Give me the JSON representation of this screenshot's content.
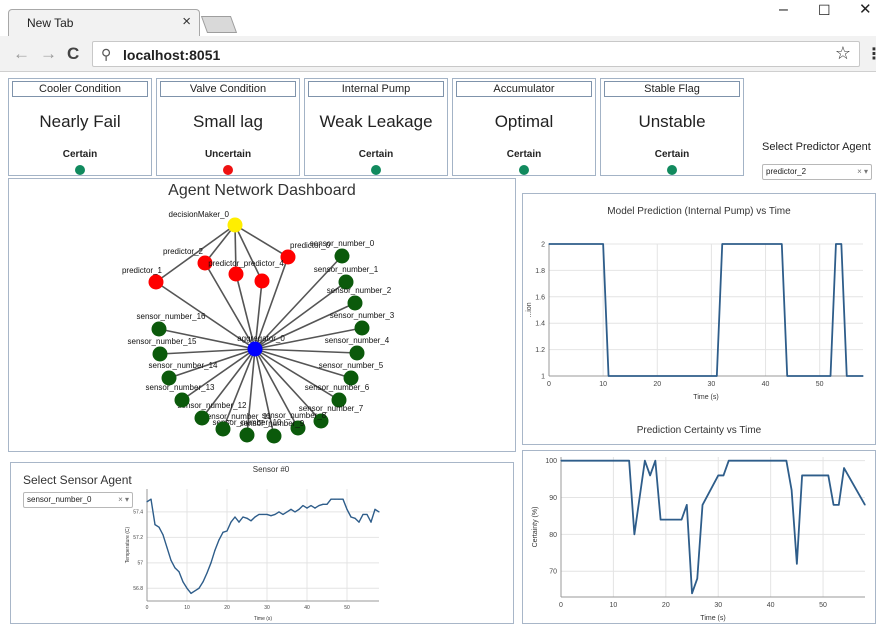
{
  "browser": {
    "tab_title": "New Tab",
    "tab_close": "×",
    "window_controls": [
      "–",
      "☐",
      "✕"
    ],
    "nav": {
      "back": "←",
      "forward": "→",
      "reload": "C",
      "search_icon": "⚲",
      "star": "☆",
      "menu": "⋮"
    },
    "url": "localhost:8051"
  },
  "cards": [
    {
      "header": "Cooler Condition",
      "value": "Nearly Fail",
      "certainty": "Certain",
      "dot_color": "#118a5e"
    },
    {
      "header": "Valve Condition",
      "value": "Small lag",
      "certainty": "Uncertain",
      "dot_color": "#ee1111"
    },
    {
      "header": "Internal Pump",
      "value": "Weak Leakage",
      "certainty": "Certain",
      "dot_color": "#118a5e"
    },
    {
      "header": "Accumulator",
      "value": "Optimal",
      "certainty": "Certain",
      "dot_color": "#118a5e"
    },
    {
      "header": "Stable Flag",
      "value": "Unstable",
      "certainty": "Certain",
      "dot_color": "#118a5e"
    }
  ],
  "predictor_select": {
    "label": "Select Predictor Agent",
    "value": "predictor_2",
    "clear": "×",
    "arrow": "▾"
  },
  "network": {
    "title": "Agent Network Dashboard",
    "colors": {
      "decision": "#ffee00",
      "predictor": "#ff0000",
      "aggregator": "#0000ff",
      "sensor": "#0b5a0b",
      "edge": "#555555"
    },
    "nodes": [
      {
        "id": "decisionMaker_0",
        "type": "decision"
      },
      {
        "id": "predictor_2",
        "type": "predictor"
      },
      {
        "id": "predictor_0",
        "type": "predictor"
      },
      {
        "id": "predictor_1",
        "type": "predictor"
      },
      {
        "id": "predictor_predictor_4",
        "type": "predictor"
      },
      {
        "id": "aggregator_0",
        "type": "aggregator"
      },
      {
        "id": "sensor_number_0",
        "type": "sensor"
      },
      {
        "id": "sensor_number_1",
        "type": "sensor"
      },
      {
        "id": "sensor_number_2",
        "type": "sensor"
      },
      {
        "id": "sensor_number_3",
        "type": "sensor"
      },
      {
        "id": "sensor_number_4",
        "type": "sensor"
      },
      {
        "id": "sensor_number_5",
        "type": "sensor"
      },
      {
        "id": "sensor_number_6",
        "type": "sensor"
      },
      {
        "id": "sensor_number_7",
        "type": "sensor"
      },
      {
        "id": "sensor_number_8",
        "type": "sensor"
      },
      {
        "id": "sensor_number_9",
        "type": "sensor"
      },
      {
        "id": "sensor_number_10",
        "type": "sensor"
      },
      {
        "id": "sensor_number_11",
        "type": "sensor"
      },
      {
        "id": "sensor_number_12",
        "type": "sensor"
      },
      {
        "id": "sensor_number_13",
        "type": "sensor"
      },
      {
        "id": "sensor_number_14",
        "type": "sensor"
      },
      {
        "id": "sensor_number_15",
        "type": "sensor"
      },
      {
        "id": "sensor_number_16",
        "type": "sensor"
      }
    ]
  },
  "sensor_select": {
    "label": "Select Sensor Agent",
    "value": "sensor_number_0",
    "clear": "×",
    "arrow": "▾"
  },
  "chart_data": [
    {
      "type": "line",
      "title": "Model Prediction (Internal Pump) vs Time",
      "xlabel": "Time (s)",
      "ylabel": "...ion",
      "xlim": [
        0,
        58
      ],
      "ylim": [
        1,
        2
      ],
      "xticks": [
        "0",
        "10",
        "20",
        "30",
        "40",
        "50"
      ],
      "yticks": [
        "1",
        "1.2",
        "1.4",
        "1.6",
        "1.8",
        "2"
      ],
      "color": "#2e5d8a",
      "x": [
        0,
        10,
        11,
        31,
        32,
        43,
        44,
        52,
        53,
        54,
        55,
        58
      ],
      "y": [
        2,
        2,
        1,
        1,
        2,
        2,
        1,
        1,
        2,
        2,
        1,
        1
      ]
    },
    {
      "type": "line",
      "title": "Prediction Certainty vs Time",
      "xlabel": "Time (s)",
      "ylabel": "Certainty (%)",
      "xlim": [
        0,
        58
      ],
      "ylim": [
        63,
        101
      ],
      "xticks": [
        "0",
        "10",
        "20",
        "30",
        "40",
        "50"
      ],
      "yticks": [
        "70",
        "80",
        "90",
        "100"
      ],
      "color": "#2e5d8a",
      "x": [
        0,
        13,
        14,
        15,
        16,
        17,
        18,
        19,
        20,
        23,
        24,
        25,
        26,
        27,
        30,
        31,
        32,
        43,
        44,
        45,
        46,
        51,
        52,
        53,
        54,
        58
      ],
      "y": [
        100,
        100,
        80,
        90,
        100,
        96,
        100,
        84,
        84,
        84,
        88,
        64,
        68,
        88,
        96,
        96,
        100,
        100,
        92,
        72,
        96,
        96,
        88,
        88,
        98,
        88
      ]
    },
    {
      "type": "line",
      "title": "Sensor #0",
      "xlabel": "Time (s)",
      "ylabel": "Temperature (C)",
      "xlim": [
        0,
        58
      ],
      "ylim": [
        56.7,
        57.58
      ],
      "xticks": [
        "0",
        "10",
        "20",
        "30",
        "40",
        "50"
      ],
      "yticks": [
        "56.8",
        "57",
        "57.2",
        "57.4"
      ],
      "color": "#2e5d8a",
      "x": [
        0,
        1,
        2,
        3,
        4,
        5,
        6,
        7,
        8,
        9,
        10,
        11,
        12,
        13,
        14,
        15,
        16,
        17,
        18,
        19,
        20,
        21,
        22,
        23,
        24,
        25,
        26,
        27,
        28,
        29,
        30,
        31,
        32,
        33,
        34,
        35,
        36,
        37,
        38,
        39,
        40,
        41,
        42,
        43,
        44,
        45,
        46,
        47,
        48,
        49,
        50,
        51,
        52,
        53,
        54,
        55,
        56,
        57,
        58
      ],
      "y": [
        57.48,
        57.5,
        57.3,
        57.28,
        57.22,
        57.12,
        57.02,
        56.96,
        56.93,
        56.85,
        56.8,
        56.76,
        56.78,
        56.8,
        56.85,
        56.92,
        57,
        57.1,
        57.18,
        57.24,
        57.25,
        57.32,
        57.36,
        57.32,
        57.36,
        57.35,
        57.33,
        57.36,
        57.38,
        57.38,
        57.38,
        57.37,
        57.38,
        57.4,
        57.38,
        57.4,
        57.42,
        57.4,
        57.42,
        57.45,
        57.43,
        57.45,
        57.43,
        57.45,
        57.46,
        57.46,
        57.5,
        57.5,
        57.5,
        57.5,
        57.42,
        57.36,
        57.35,
        57.32,
        57.38,
        57.38,
        57.32,
        57.42,
        57.4
      ]
    }
  ]
}
